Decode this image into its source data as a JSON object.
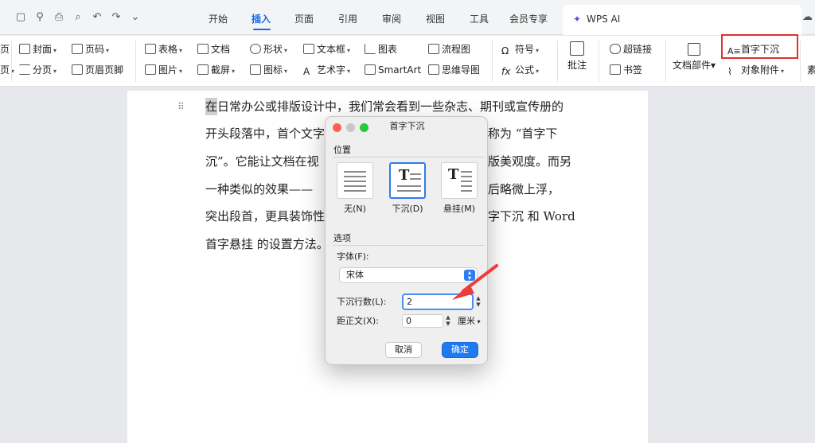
{
  "tabs": [
    {
      "label": "开始"
    },
    {
      "label": "插入"
    },
    {
      "label": "页面"
    },
    {
      "label": "引用"
    },
    {
      "label": "审阅"
    },
    {
      "label": "视图"
    },
    {
      "label": "工具"
    },
    {
      "label": "会员专享"
    },
    {
      "label": "WPS AI"
    }
  ],
  "ribbon": {
    "row1": [
      "封面",
      "页码",
      "表格",
      "文档",
      "形状",
      "文本框",
      "图表",
      "流程图",
      "符号",
      "超链接"
    ],
    "row2": [
      "分页",
      "页眉页脚",
      "图片",
      "截屏",
      "图标",
      "艺术字",
      "SmartArt",
      "思维导图",
      "公式",
      "书签"
    ],
    "comment": "批注",
    "doc_parts": "文档部件",
    "drop_cap": "首字下沉",
    "attachment": "对象附件",
    "cut_left_top": "页",
    "cut_left_bottom": "页",
    "cut_right": "素"
  },
  "document": {
    "lines": [
      "在日常办公或排版设计中，我们常会看到一些杂志、期刊或宣传册的",
      "开头段落中，首个文字",
      "沉”。它能让文档在视",
      "一种类似的效果——",
      "突出段首，更具装饰性",
      "首字悬挂  的设置方法。"
    ],
    "right_fragments": [
      "称为 “首字下",
      "版美观度。而另",
      "后略微上浮，",
      "字下沉 和 Word"
    ]
  },
  "dialog": {
    "title": "首字下沉",
    "position_label": "位置",
    "positions": [
      {
        "label": "无(N)"
      },
      {
        "label": "下沉(D)"
      },
      {
        "label": "悬挂(M)"
      }
    ],
    "options_label": "选项",
    "font_label": "字体(F):",
    "font_value": "宋体",
    "lines_label": "下沉行数(L):",
    "lines_value": "2",
    "distance_label": "距正文(X):",
    "distance_value": "0",
    "unit": "厘米",
    "cancel": "取消",
    "ok": "确定"
  },
  "colors": {
    "accent": "#1a66e6",
    "highlight": "#e03030",
    "ok_button": "#1f7af0"
  }
}
